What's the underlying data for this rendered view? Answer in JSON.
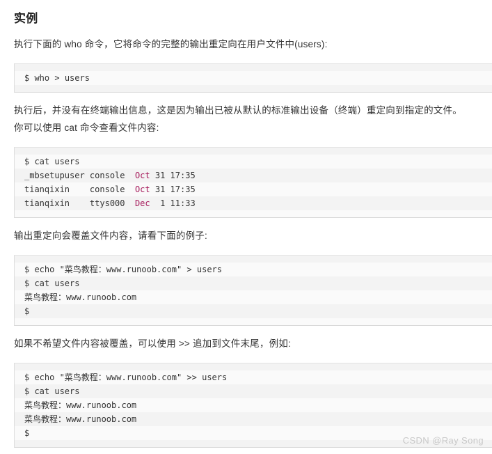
{
  "page": {
    "title": "实例",
    "watermark": "CSDN @Ray Song",
    "colors": {
      "string": "#008000",
      "operator": "#7a6a21",
      "month": "#a71d5d",
      "number": "#0086b3",
      "code_bg": "#fafafa",
      "code_bg_alt": "#f3f3f3",
      "border": "#dddddd",
      "text": "#333333",
      "watermark": "#c9c9c9"
    }
  },
  "paragraphs": {
    "p1": "执行下面的 who 命令，它将命令的完整的输出重定向在用户文件中(users):",
    "p2": "执行后，并没有在终端输出信息，这是因为输出已被从默认的标准输出设备（终端）重定向到指定的文件。",
    "p3": "你可以使用 cat 命令查看文件内容:",
    "p4": "输出重定向会覆盖文件内容，请看下面的例子:",
    "p5": "如果不希望文件内容被覆盖，可以使用 >> 追加到文件末尾，例如:"
  },
  "code_blocks": {
    "block1": {
      "lines": [
        {
          "parts": [
            {
              "t": "$ who ",
              "c": "plain"
            },
            {
              "t": ">",
              "c": "operator"
            },
            {
              "t": " users",
              "c": "plain"
            }
          ]
        }
      ]
    },
    "block2": {
      "lines": [
        {
          "parts": [
            {
              "t": "$ cat users",
              "c": "plain"
            }
          ]
        },
        {
          "parts": [
            {
              "t": "_mbsetupuser console  ",
              "c": "plain"
            },
            {
              "t": "Oct",
              "c": "month"
            },
            {
              "t": " ",
              "c": "plain"
            },
            {
              "t": "31 17:35",
              "c": "number"
            }
          ]
        },
        {
          "parts": [
            {
              "t": "tianqixin    console  ",
              "c": "plain"
            },
            {
              "t": "Oct",
              "c": "month"
            },
            {
              "t": " ",
              "c": "plain"
            },
            {
              "t": "31 17:35",
              "c": "number"
            }
          ]
        },
        {
          "parts": [
            {
              "t": "tianqixin    ttys000  ",
              "c": "plain"
            },
            {
              "t": "Dec",
              "c": "month"
            },
            {
              "t": "  ",
              "c": "plain"
            },
            {
              "t": "1 11:33",
              "c": "number"
            }
          ]
        }
      ]
    },
    "block3": {
      "lines": [
        {
          "parts": [
            {
              "t": "$ echo ",
              "c": "plain"
            },
            {
              "t": "\"菜鸟教程：www.runoob.com\"",
              "c": "string"
            },
            {
              "t": " ",
              "c": "plain"
            },
            {
              "t": ">",
              "c": "operator"
            },
            {
              "t": " users",
              "c": "plain"
            }
          ]
        },
        {
          "parts": [
            {
              "t": "$ cat users",
              "c": "plain"
            }
          ]
        },
        {
          "parts": [
            {
              "t": "菜鸟教程：www.runoob.com",
              "c": "plain"
            }
          ]
        },
        {
          "parts": [
            {
              "t": "$",
              "c": "plain"
            }
          ]
        }
      ]
    },
    "block4": {
      "lines": [
        {
          "parts": [
            {
              "t": "$ echo ",
              "c": "plain"
            },
            {
              "t": "\"菜鸟教程：www.runoob.com\"",
              "c": "string"
            },
            {
              "t": " ",
              "c": "plain"
            },
            {
              "t": ">>",
              "c": "operator"
            },
            {
              "t": " users",
              "c": "plain"
            }
          ]
        },
        {
          "parts": [
            {
              "t": "$ cat users",
              "c": "plain"
            }
          ]
        },
        {
          "parts": [
            {
              "t": "菜鸟教程：www.runoob.com",
              "c": "plain"
            }
          ]
        },
        {
          "parts": [
            {
              "t": "菜鸟教程：www.runoob.com",
              "c": "plain"
            }
          ]
        },
        {
          "parts": [
            {
              "t": "$",
              "c": "plain"
            }
          ]
        }
      ]
    }
  }
}
